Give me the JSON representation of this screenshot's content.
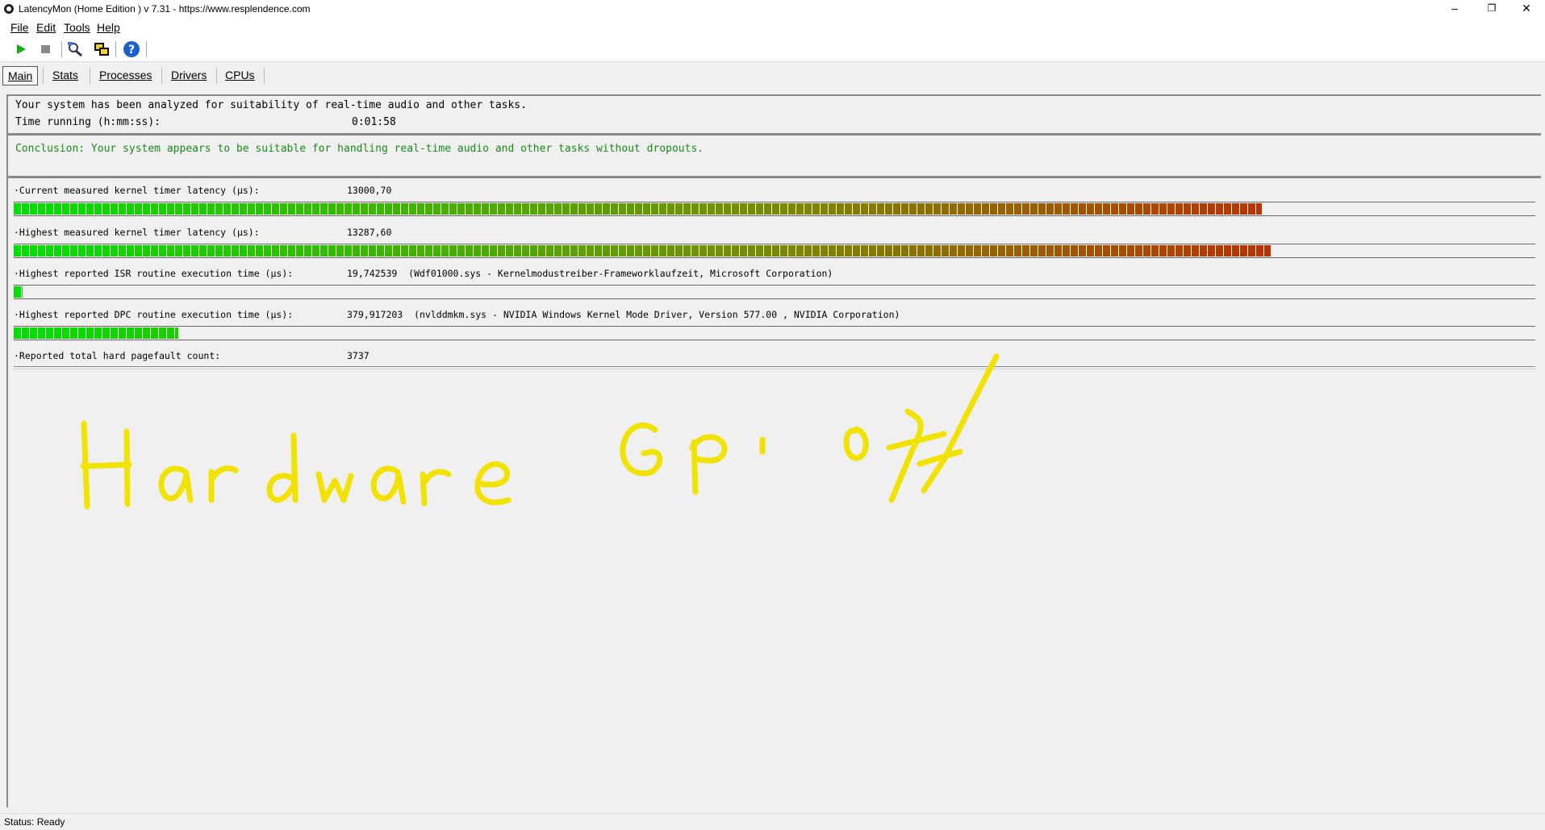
{
  "window": {
    "title": "LatencyMon  (Home Edition )  v 7.31 - https://www.resplendence.com",
    "minimize": "–",
    "maximize": "❐",
    "close": "✕"
  },
  "menu": [
    "File",
    "Edit",
    "Tools",
    "Help"
  ],
  "toolbar": {
    "icons": [
      "play-icon",
      "stop-icon",
      "search-icon",
      "windows-icon",
      "help-icon"
    ]
  },
  "tabs": [
    "Main",
    "Stats",
    "Processes",
    "Drivers",
    "CPUs"
  ],
  "info": {
    "analyzed": "Your system has been analyzed for suitability of real-time audio and other tasks.",
    "time_label": "Time running (h:mm:ss):",
    "time_value": "0:01:58",
    "conclusion": "Conclusion: Your system appears to be suitable for handling real-time audio and other tasks without dropouts."
  },
  "metrics": [
    {
      "label": "·Current measured kernel timer latency (µs):",
      "value": "13000,70",
      "fill": 0.82
    },
    {
      "label": "·Highest measured kernel timer latency (µs):",
      "value": "13287,60",
      "fill": 0.826
    },
    {
      "label": "·Highest reported ISR routine execution time (µs):",
      "value": "19,742539  (Wdf01000.sys - Kernelmodustreiber-Frameworklaufzeit, Microsoft Corporation)",
      "fill": 0.006
    },
    {
      "label": "·Highest reported DPC routine execution time (µs):",
      "value": "379,917203  (nvlddmkm.sys - NVIDIA Windows Kernel Mode Driver, Version 577.00 , NVIDIA Corporation)",
      "fill": 0.108
    },
    {
      "label": "·Reported total hard pagefault count:",
      "value": "3737"
    }
  ],
  "annotation_text": "Hardware Gpu off",
  "colors": {
    "green": "#00e000",
    "mid": "#7a8a00",
    "red": "#e00000",
    "conclusion": "#1a8a1a",
    "annotation": "#f2e200"
  },
  "status": "Status: Ready"
}
